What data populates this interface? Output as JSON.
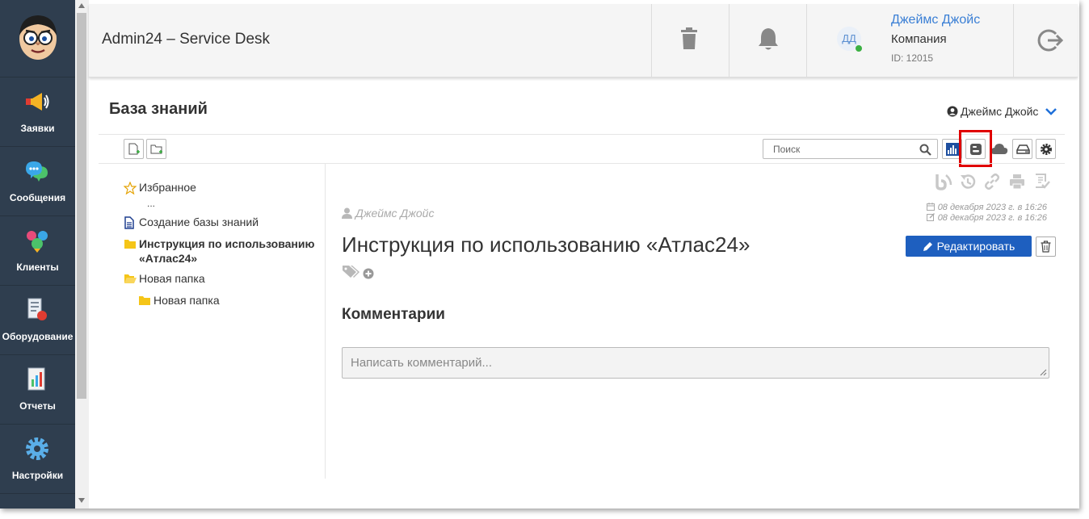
{
  "app": {
    "title": "Admin24 – Service Desk"
  },
  "sidebar": {
    "items": [
      {
        "label": "Заявки",
        "icon": "megaphone-icon"
      },
      {
        "label": "Сообщения",
        "icon": "chat-bubbles-icon"
      },
      {
        "label": "Клиенты",
        "icon": "clients-icon"
      },
      {
        "label": "Оборудование",
        "icon": "equipment-icon"
      },
      {
        "label": "Отчеты",
        "icon": "reports-icon"
      },
      {
        "label": "Настройки",
        "icon": "gear-icon"
      }
    ]
  },
  "header": {
    "user": {
      "initials": "ДД",
      "name": "Джеймс Джойс",
      "company": "Компания",
      "id": "ID: 12015"
    }
  },
  "page": {
    "title": "База знаний",
    "owner": "Джеймс Джойс"
  },
  "search": {
    "placeholder": "Поиск"
  },
  "tree": {
    "items": [
      {
        "label": "Избранное",
        "icon": "star-outline-icon"
      },
      {
        "label": "...",
        "icon": ""
      },
      {
        "label": "Создание базы знаний",
        "icon": "document-icon"
      },
      {
        "label": "Инструкция по использованию",
        "label2": "«Атлас24»",
        "icon": "folder-icon"
      },
      {
        "label": "Новая папка",
        "icon": "folder-open-icon"
      },
      {
        "label": "Новая папка",
        "icon": "folder-icon"
      }
    ]
  },
  "article": {
    "author": "Джеймс Джойс",
    "created": "08 декабря 2023 г. в 16:26",
    "modified": "08 декабря 2023 г. в 16:26",
    "title": "Инструкция по использованию «Атлас24»",
    "edit_label": "Редактировать",
    "comments_title": "Комментарии",
    "comment_placeholder": "Написать комментарий..."
  },
  "colors": {
    "sidebar_bg": "#2f3e4f",
    "accent": "#1e5fbf",
    "link": "#3a7fd5",
    "highlight": "#e00000",
    "folder": "#f5c518"
  }
}
